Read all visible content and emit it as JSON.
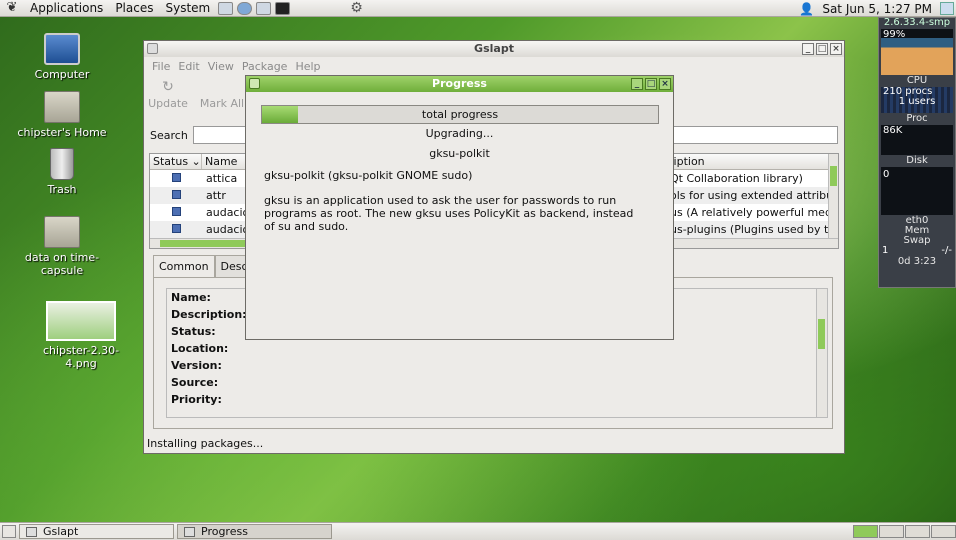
{
  "top_panel": {
    "menus": [
      "Applications",
      "Places",
      "System"
    ],
    "clock": "Sat Jun  5,  1:27 PM"
  },
  "desktop": {
    "icons": [
      {
        "label": "Computer"
      },
      {
        "label": "chipster's Home"
      },
      {
        "label": "Trash"
      },
      {
        "label": "data on time-capsule"
      },
      {
        "label": "chipster-2.30-4.png"
      }
    ]
  },
  "gslapt": {
    "title": "Gslapt",
    "menu": [
      "File",
      "Edit",
      "View",
      "Package",
      "Help"
    ],
    "toolbar": [
      "Update",
      "Mark All"
    ],
    "search_label": "Search",
    "columns": [
      "Status",
      "Name",
      "Description"
    ],
    "packages": [
      {
        "name": "attica",
        "desc": "Qt Collaboration library)"
      },
      {
        "name": "attr",
        "desc": "ols for using extended attribu"
      },
      {
        "name": "audaciou",
        "desc": "us (A relatively powerful med"
      },
      {
        "name": "audaciou",
        "desc": "us-plugins (Plugins used by t"
      }
    ],
    "tabs": [
      "Common",
      "Descri"
    ],
    "fields": [
      "Name:",
      "Description:",
      "Status:",
      "Location:",
      "Version:",
      "Source:",
      "Priority:"
    ],
    "status": "Installing packages..."
  },
  "progress": {
    "title": "Progress",
    "bar_label": "total progress",
    "fraction": 0.09,
    "action": "Upgrading...",
    "package": "gksu-polkit",
    "heading": "gksu-polkit (gksu-polkit GNOME sudo)",
    "description": "gksu is an application used to ask the user for passwords to run programs as root. The new gksu uses PolicyKit as backend, instead of su and sudo."
  },
  "monitor": {
    "version": "2.6.33.4-smp",
    "cpu_percent": "99%",
    "cpu": "CPU",
    "procs": "210 procs",
    "users": "1 users",
    "proc": "Proc",
    "proc_val": "86K",
    "disk": "Disk",
    "disk_val": "0",
    "net": "eth0",
    "mem": "Mem",
    "swap": "Swap",
    "swap_val": "-/-",
    "one": "1",
    "uptime": "0d  3:23"
  },
  "taskbar": {
    "tasks": [
      "Gslapt",
      "Progress"
    ]
  }
}
